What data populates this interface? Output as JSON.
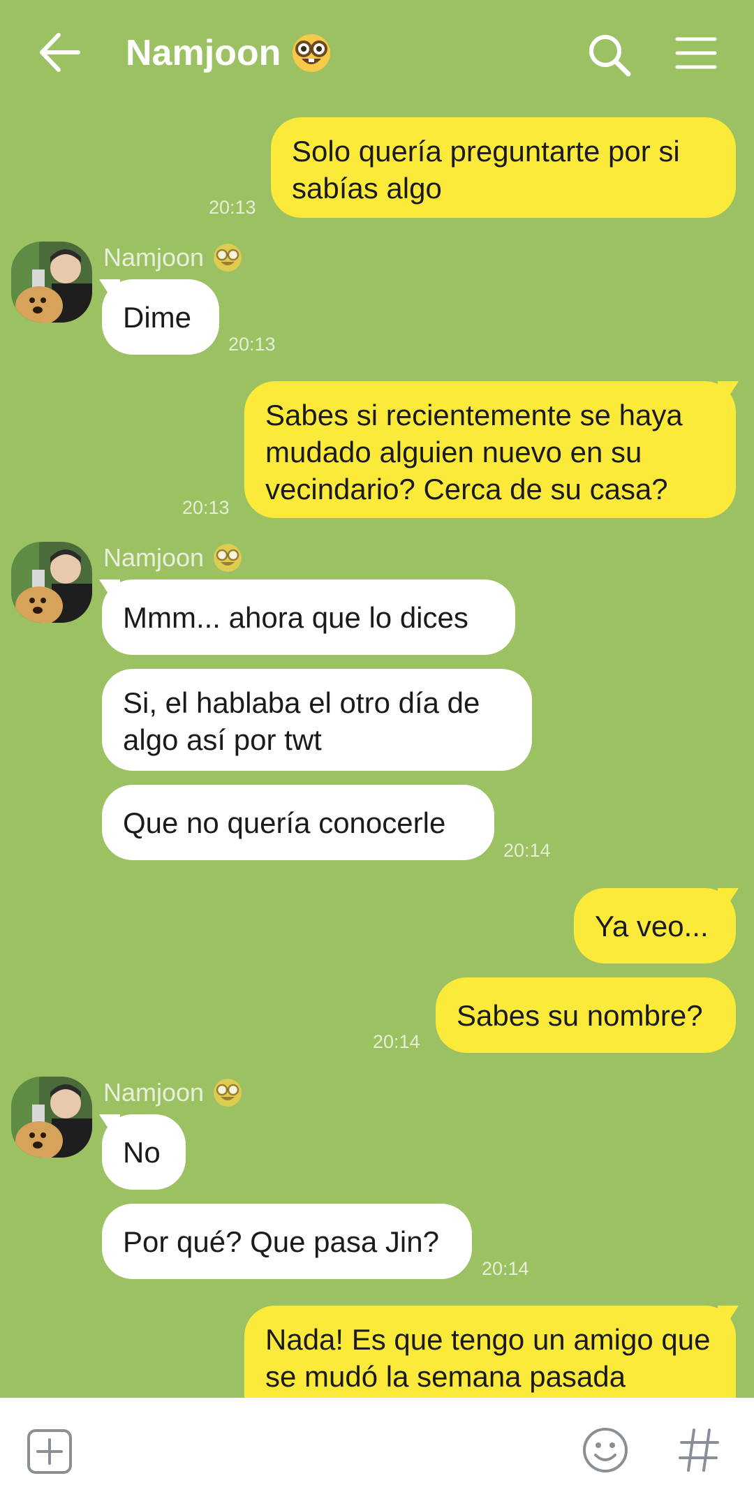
{
  "header": {
    "contact_name": "Namjoon",
    "contact_emoji": "nerd-face",
    "back": "arrow-left-icon",
    "search": "search-icon",
    "menu": "hamburger-icon"
  },
  "colors": {
    "background": "#9bc162",
    "outgoing_bubble": "#fcea3a",
    "incoming_bubble": "#ffffff",
    "timestamp": "#e4efd3"
  },
  "messages": [
    {
      "dir": "out",
      "text": "Solo quería preguntarte por si sabías algo",
      "time": "20:13"
    },
    {
      "dir": "in",
      "sender": "Namjoon",
      "text": "Dime",
      "time": "20:13"
    },
    {
      "dir": "out",
      "text": "Sabes si recientemente se haya mudado alguien nuevo en su vecindario? Cerca de su casa?",
      "time": "20:13"
    },
    {
      "dir": "in",
      "sender": "Namjoon",
      "text": "Mmm... ahora que lo dices"
    },
    {
      "dir": "in",
      "text": "Si, el hablaba el otro día de algo así por twt"
    },
    {
      "dir": "in",
      "text": "Que no quería conocerle",
      "time": "20:14"
    },
    {
      "dir": "out",
      "text": "Ya veo..."
    },
    {
      "dir": "out",
      "text": "Sabes su nombre?",
      "time": "20:14"
    },
    {
      "dir": "in",
      "sender": "Namjoon",
      "text": "No"
    },
    {
      "dir": "in",
      "text": "Por qué? Que pasa Jin?",
      "time": "20:14"
    },
    {
      "dir": "out",
      "text": "Nada! Es que tengo un amigo que se mudó la semana pasada"
    }
  ],
  "composer": {
    "attach": "plus-square-icon",
    "sticker": "smiley-icon",
    "hashtag": "hash-icon"
  }
}
